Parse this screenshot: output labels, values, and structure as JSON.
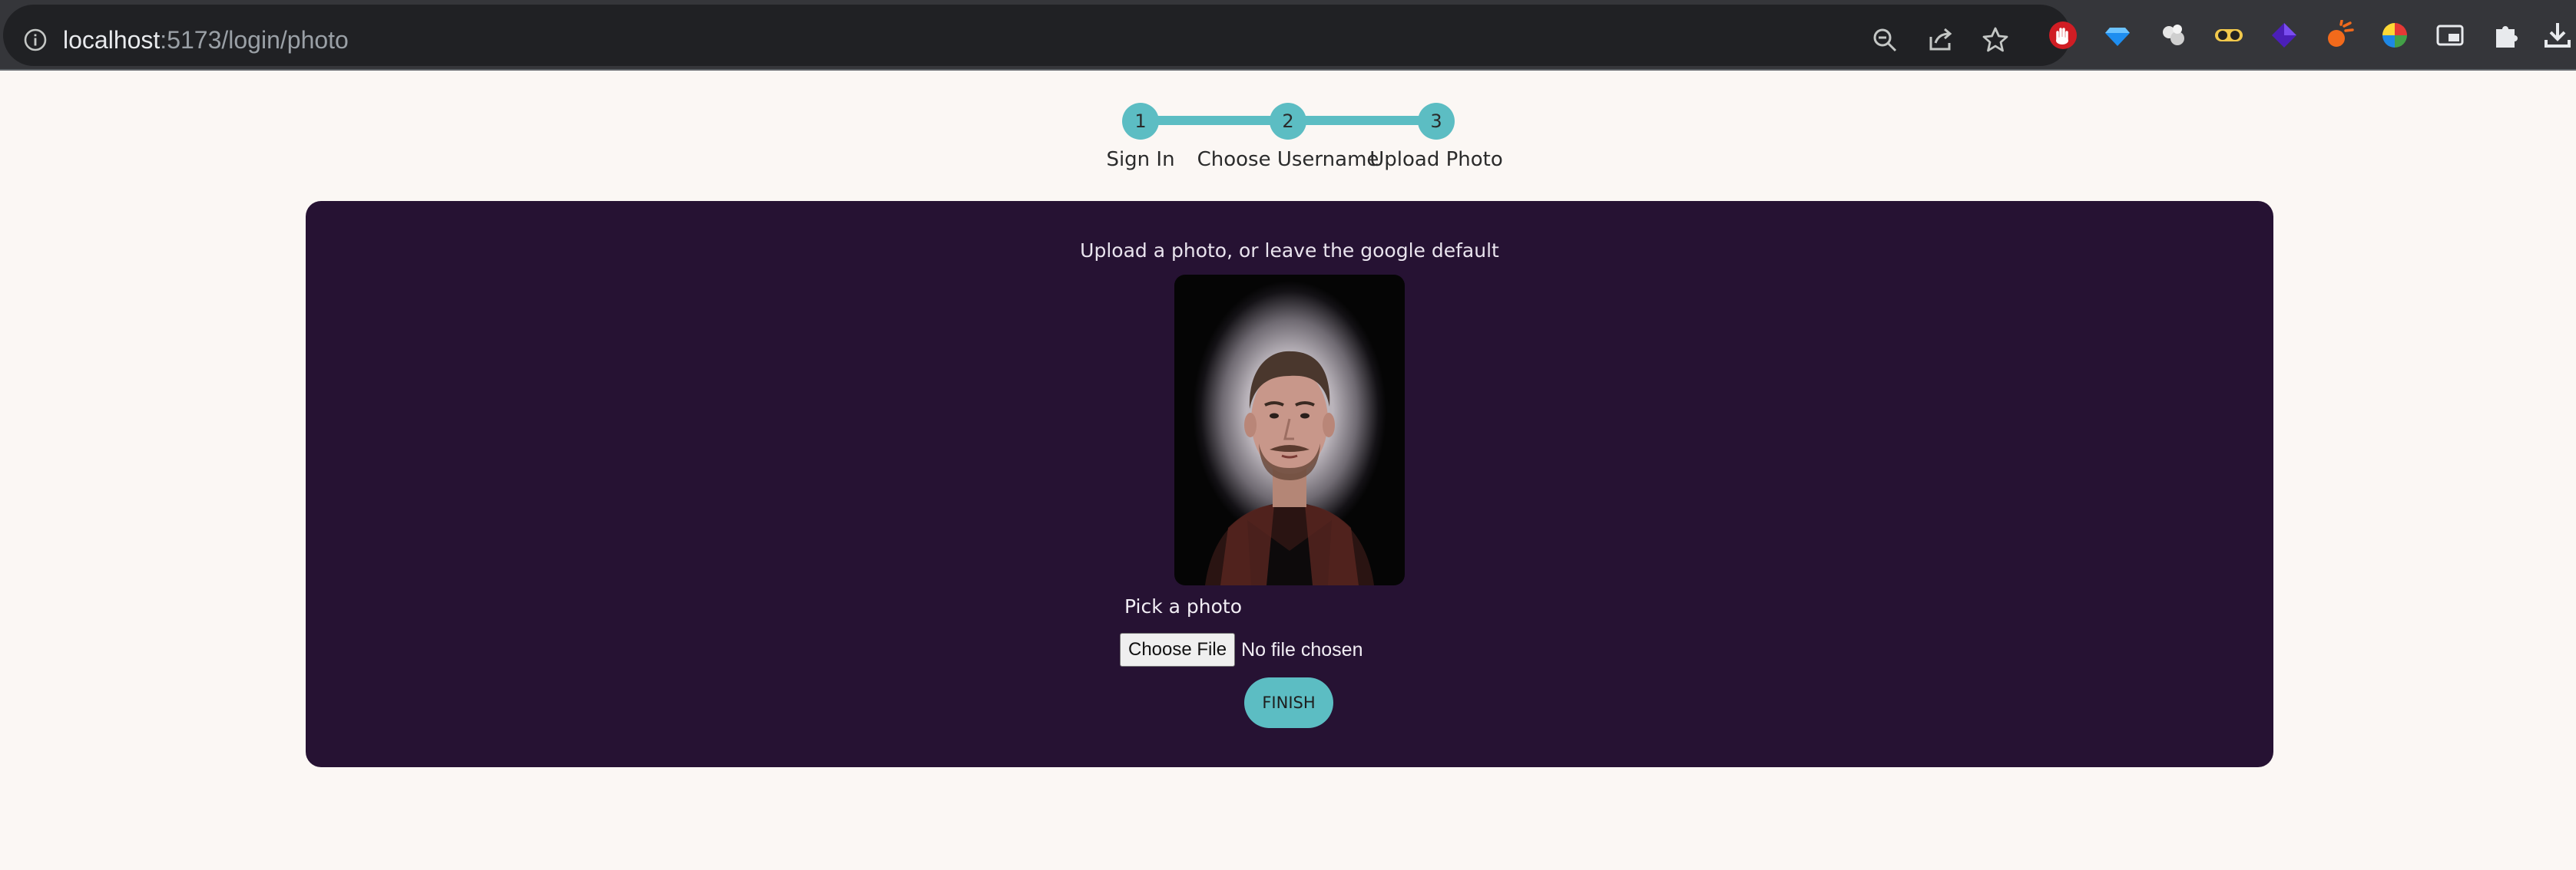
{
  "browser": {
    "url_host": "localhost",
    "url_path": ":5173/login/photo",
    "omnibox_icons": [
      "zoom-out-icon",
      "share-icon",
      "bookmark-star-icon"
    ],
    "extension_icons": [
      "hand-stop-extension-icon",
      "diamond-extension-icon",
      "clouds-extension-icon",
      "goggles-extension-icon",
      "purple-gem-extension-icon",
      "orange-spark-extension-icon",
      "color-wheel-extension-icon",
      "picture-in-picture-icon",
      "puzzle-extensions-icon",
      "download-icon"
    ]
  },
  "stepper": {
    "accent_color": "#5cbdc3",
    "steps": [
      {
        "number": "1",
        "label": "Sign In"
      },
      {
        "number": "2",
        "label": "Choose Username"
      },
      {
        "number": "3",
        "label": "Upload Photo"
      }
    ],
    "current_step": 3
  },
  "panel": {
    "background_color": "#261233",
    "prompt": "Upload a photo, or leave the google default",
    "photo_description_icon": "profile-photo",
    "pick_label": "Pick a photo",
    "choose_file_label": "Choose File",
    "no_file_text": "No file chosen",
    "finish_label": "FINISH"
  }
}
